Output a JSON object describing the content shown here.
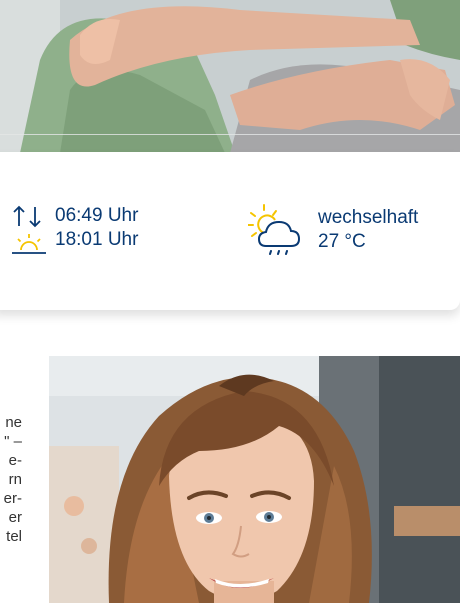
{
  "sun": {
    "sunrise": "06:49 Uhr",
    "sunset": "18:01 Uhr",
    "icon": "sunrise-sunset-icon"
  },
  "weather": {
    "condition": "wechselhaft",
    "temperature": "27 °C",
    "icon": "partly-cloudy-rain-icon"
  },
  "article": {
    "lines": [
      "ne",
      "\" –",
      "e-",
      "rn",
      "er-",
      "er",
      "tel"
    ]
  },
  "colors": {
    "text_blue": "#0a3a73",
    "sun_yellow": "#f5c400",
    "body_text": "#333333"
  }
}
